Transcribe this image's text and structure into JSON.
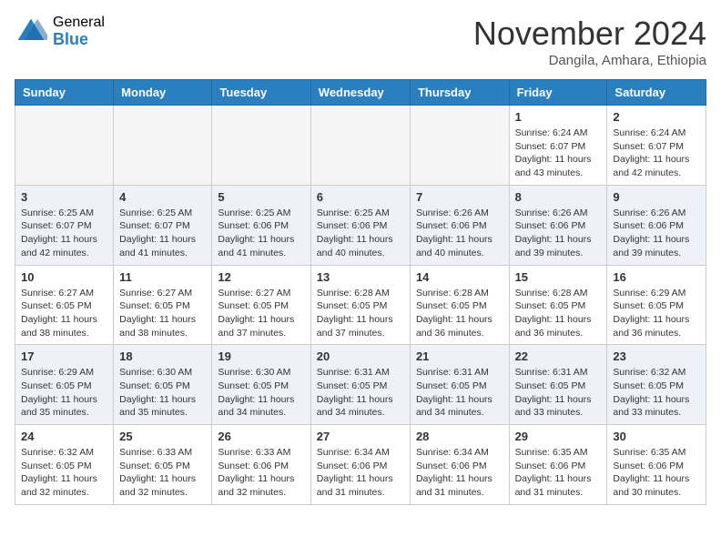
{
  "header": {
    "logo_general": "General",
    "logo_blue": "Blue",
    "month": "November 2024",
    "location": "Dangila, Amhara, Ethiopia"
  },
  "weekdays": [
    "Sunday",
    "Monday",
    "Tuesday",
    "Wednesday",
    "Thursday",
    "Friday",
    "Saturday"
  ],
  "weeks": [
    [
      {
        "day": "",
        "info": ""
      },
      {
        "day": "",
        "info": ""
      },
      {
        "day": "",
        "info": ""
      },
      {
        "day": "",
        "info": ""
      },
      {
        "day": "",
        "info": ""
      },
      {
        "day": "1",
        "info": "Sunrise: 6:24 AM\nSunset: 6:07 PM\nDaylight: 11 hours and 43 minutes."
      },
      {
        "day": "2",
        "info": "Sunrise: 6:24 AM\nSunset: 6:07 PM\nDaylight: 11 hours and 42 minutes."
      }
    ],
    [
      {
        "day": "3",
        "info": "Sunrise: 6:25 AM\nSunset: 6:07 PM\nDaylight: 11 hours and 42 minutes."
      },
      {
        "day": "4",
        "info": "Sunrise: 6:25 AM\nSunset: 6:07 PM\nDaylight: 11 hours and 41 minutes."
      },
      {
        "day": "5",
        "info": "Sunrise: 6:25 AM\nSunset: 6:06 PM\nDaylight: 11 hours and 41 minutes."
      },
      {
        "day": "6",
        "info": "Sunrise: 6:25 AM\nSunset: 6:06 PM\nDaylight: 11 hours and 40 minutes."
      },
      {
        "day": "7",
        "info": "Sunrise: 6:26 AM\nSunset: 6:06 PM\nDaylight: 11 hours and 40 minutes."
      },
      {
        "day": "8",
        "info": "Sunrise: 6:26 AM\nSunset: 6:06 PM\nDaylight: 11 hours and 39 minutes."
      },
      {
        "day": "9",
        "info": "Sunrise: 6:26 AM\nSunset: 6:06 PM\nDaylight: 11 hours and 39 minutes."
      }
    ],
    [
      {
        "day": "10",
        "info": "Sunrise: 6:27 AM\nSunset: 6:05 PM\nDaylight: 11 hours and 38 minutes."
      },
      {
        "day": "11",
        "info": "Sunrise: 6:27 AM\nSunset: 6:05 PM\nDaylight: 11 hours and 38 minutes."
      },
      {
        "day": "12",
        "info": "Sunrise: 6:27 AM\nSunset: 6:05 PM\nDaylight: 11 hours and 37 minutes."
      },
      {
        "day": "13",
        "info": "Sunrise: 6:28 AM\nSunset: 6:05 PM\nDaylight: 11 hours and 37 minutes."
      },
      {
        "day": "14",
        "info": "Sunrise: 6:28 AM\nSunset: 6:05 PM\nDaylight: 11 hours and 36 minutes."
      },
      {
        "day": "15",
        "info": "Sunrise: 6:28 AM\nSunset: 6:05 PM\nDaylight: 11 hours and 36 minutes."
      },
      {
        "day": "16",
        "info": "Sunrise: 6:29 AM\nSunset: 6:05 PM\nDaylight: 11 hours and 36 minutes."
      }
    ],
    [
      {
        "day": "17",
        "info": "Sunrise: 6:29 AM\nSunset: 6:05 PM\nDaylight: 11 hours and 35 minutes."
      },
      {
        "day": "18",
        "info": "Sunrise: 6:30 AM\nSunset: 6:05 PM\nDaylight: 11 hours and 35 minutes."
      },
      {
        "day": "19",
        "info": "Sunrise: 6:30 AM\nSunset: 6:05 PM\nDaylight: 11 hours and 34 minutes."
      },
      {
        "day": "20",
        "info": "Sunrise: 6:31 AM\nSunset: 6:05 PM\nDaylight: 11 hours and 34 minutes."
      },
      {
        "day": "21",
        "info": "Sunrise: 6:31 AM\nSunset: 6:05 PM\nDaylight: 11 hours and 34 minutes."
      },
      {
        "day": "22",
        "info": "Sunrise: 6:31 AM\nSunset: 6:05 PM\nDaylight: 11 hours and 33 minutes."
      },
      {
        "day": "23",
        "info": "Sunrise: 6:32 AM\nSunset: 6:05 PM\nDaylight: 11 hours and 33 minutes."
      }
    ],
    [
      {
        "day": "24",
        "info": "Sunrise: 6:32 AM\nSunset: 6:05 PM\nDaylight: 11 hours and 32 minutes."
      },
      {
        "day": "25",
        "info": "Sunrise: 6:33 AM\nSunset: 6:05 PM\nDaylight: 11 hours and 32 minutes."
      },
      {
        "day": "26",
        "info": "Sunrise: 6:33 AM\nSunset: 6:06 PM\nDaylight: 11 hours and 32 minutes."
      },
      {
        "day": "27",
        "info": "Sunrise: 6:34 AM\nSunset: 6:06 PM\nDaylight: 11 hours and 31 minutes."
      },
      {
        "day": "28",
        "info": "Sunrise: 6:34 AM\nSunset: 6:06 PM\nDaylight: 11 hours and 31 minutes."
      },
      {
        "day": "29",
        "info": "Sunrise: 6:35 AM\nSunset: 6:06 PM\nDaylight: 11 hours and 31 minutes."
      },
      {
        "day": "30",
        "info": "Sunrise: 6:35 AM\nSunset: 6:06 PM\nDaylight: 11 hours and 30 minutes."
      }
    ]
  ]
}
